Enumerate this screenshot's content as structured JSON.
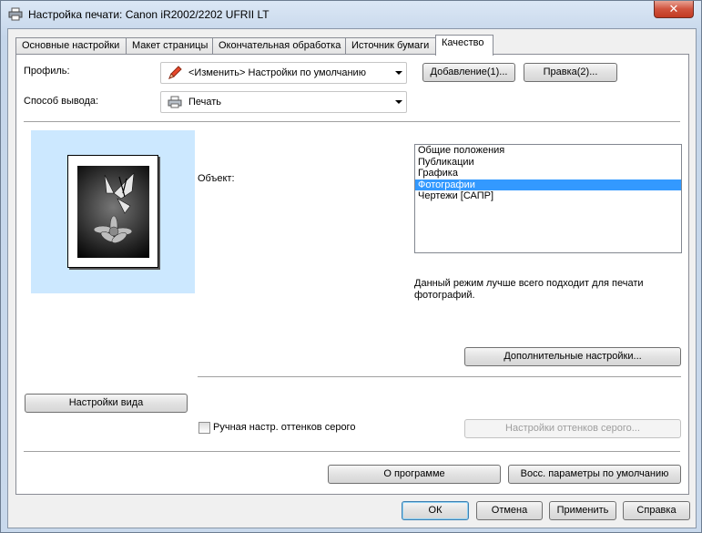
{
  "window": {
    "title": "Настройка печати: Canon iR2002/2202 UFRII LT",
    "close_label": "✕"
  },
  "tabs": [
    {
      "label": "Основные настройки",
      "active": false
    },
    {
      "label": "Макет страницы",
      "active": false
    },
    {
      "label": "Окончательная обработка",
      "active": false
    },
    {
      "label": "Источник бумаги",
      "active": false
    },
    {
      "label": "Качество",
      "active": true
    }
  ],
  "profile": {
    "label": "Профиль:",
    "value": "<Изменить> Настройки по умолчанию",
    "icon": "pencil-icon",
    "add_button": "Добавление(1)...",
    "edit_button": "Правка(2)..."
  },
  "output": {
    "label": "Способ вывода:",
    "value": "Печать",
    "icon": "printer-icon"
  },
  "object": {
    "label": "Объект:",
    "items": [
      {
        "label": "Общие положения",
        "selected": false
      },
      {
        "label": "Публикации",
        "selected": false
      },
      {
        "label": "Графика",
        "selected": false
      },
      {
        "label": "Фотографии",
        "selected": true
      },
      {
        "label": "Чертежи [САПР]",
        "selected": false
      }
    ],
    "description": "Данный режим лучше всего подходит для печати фотографий."
  },
  "buttons": {
    "advanced": "Дополнительные настройки...",
    "view_settings": "Настройки вида",
    "grayscale_settings": "Настройки оттенков серого...",
    "about": "О программе",
    "restore_defaults": "Восс. параметры по умолчанию",
    "ok": "ОК",
    "cancel": "Отмена",
    "apply": "Применить",
    "help": "Справка"
  },
  "grayscale": {
    "label": "Ручная настр. оттенков серого",
    "checked": false
  },
  "colors": {
    "selection": "#3399ff",
    "preview_bg": "#cce8ff",
    "close_red": "#c23a22"
  }
}
